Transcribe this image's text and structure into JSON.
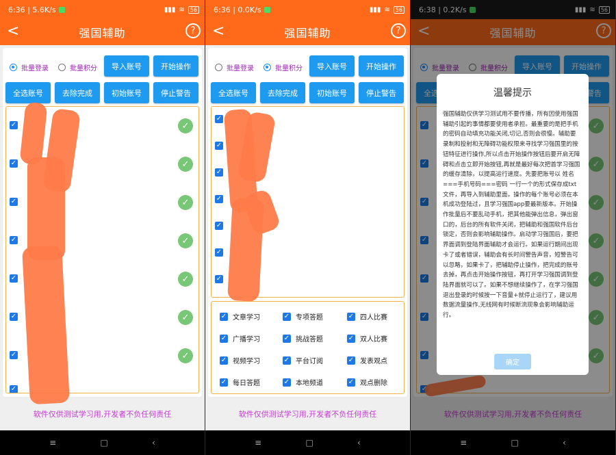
{
  "app": {
    "title": "强国辅助",
    "help": "?",
    "back": "<"
  },
  "status": [
    {
      "time": "6:36",
      "speed": "5.6K/s",
      "signal": "▮▮▮",
      "battery": "56"
    },
    {
      "time": "6:36",
      "speed": "0.0K/s",
      "signal": "▮▮▮",
      "battery": "56"
    },
    {
      "time": "6:38",
      "speed": "0.2K/s",
      "signal": "▮▮▮",
      "battery": "56"
    }
  ],
  "controls": {
    "radio_login": "批量登录",
    "radio_points": "批量积分",
    "import": "导入账号",
    "start": "开始操作",
    "select_all": "全选账号",
    "remove_done": "去除完成",
    "init": "初始账号",
    "stop_alarm": "停止警告"
  },
  "options": [
    [
      "文章学习",
      "专项答题",
      "四人比赛"
    ],
    [
      "广播学习",
      "挑战答题",
      "双人比赛"
    ],
    [
      "视频学习",
      "平台订阅",
      "发表观点"
    ],
    [
      "每日答题",
      "本地频道",
      "观点删除"
    ]
  ],
  "footer": "软件仅供测试学习用,开发者不负任何责任",
  "nav": {
    "menu": "≡",
    "home": "□",
    "back": "‹"
  },
  "dialog": {
    "title": "温馨提示",
    "body": "强国辅助仅供学习测试用不要传播，所有因使用强国辅助引起的事情都要使用者承担。最重要的是把手机的密码自动填充功能关闭,切记,否则会很慢。辅助要录制和投射和无障碍功能权限来寻找学习强国里的按钮特征进行操作,所以点击开始操作按钮后要开启无障碍和点击立即开始按钮,再就是最好每次把首学习强国的缓存清除，以提高运行速度。先要把账号以  姓名===手机号码===密码 一行一个的形式保存成txt文件，再导入到辅助里面，操作的每个账号必须在本机成功登陆过，且学习强国app要最新版本。开始操作批量后不要乱动手机，把其他能弹出信息，弹出窗口的，后台的所有软件关闭，把辅助和强国软件后台锁定，否则会影响辅助操作。启动学习强国后，要把界面调到登陆界面辅助才会运行。如果运行期间出现卡了或者错误，辅助会有长时间警告声音，短警告可以忽略，如果卡了，把辅助停止操作，把完成的账号去掉，再点击开始操作按钮，再打开学习强国调到登陆界面就可以了。如果不想继续操作了，在学习强国退出登录的时候按一下音量+就停止运行了，建议用数据流量操作,无线网有时候断流现象会影响辅助运行。",
    "confirm": "确定"
  },
  "colors": {
    "accent": "#ff6a1a",
    "button": "#1e9bf0",
    "checkbox": "#1e78e6",
    "done": "#77c777",
    "footer_text": "#c53bd3"
  },
  "icons": {
    "check": "✓"
  }
}
